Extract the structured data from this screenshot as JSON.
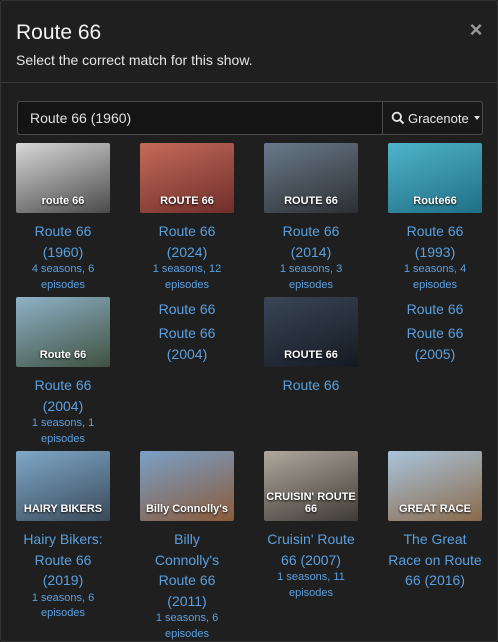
{
  "header": {
    "title": "Route 66",
    "subtitle": "Select the correct match for this show.",
    "close_glyph": "×"
  },
  "search": {
    "value": "Route 66 (1960)",
    "provider_label": "Gracenote"
  },
  "results": [
    {
      "name_lines": [
        "Route 66",
        "(1960)"
      ],
      "meta_lines": [
        "4 seasons, 6",
        "episodes"
      ],
      "thumb_text": "route 66",
      "thumb_colors": [
        "#d8d8d8",
        "#4a4a4a"
      ]
    },
    {
      "name_lines": [
        "Route 66",
        "(2024)"
      ],
      "meta_lines": [
        "1 seasons, 12",
        "episodes"
      ],
      "thumb_text": "ROUTE 66",
      "thumb_colors": [
        "#c56a5a",
        "#6e2e2a"
      ]
    },
    {
      "name_lines": [
        "Route 66",
        "(2014)"
      ],
      "meta_lines": [
        "1 seasons, 3",
        "episodes"
      ],
      "thumb_text": "ROUTE 66",
      "thumb_colors": [
        "#6a7a8a",
        "#2c2f33"
      ]
    },
    {
      "name_lines": [
        "Route 66",
        "(1993)"
      ],
      "meta_lines": [
        "1 seasons, 4",
        "episodes"
      ],
      "thumb_text": "Route66",
      "thumb_colors": [
        "#4fb3c9",
        "#1f6f86"
      ]
    },
    {
      "name_lines": [
        "Route 66",
        "(2004)"
      ],
      "meta_lines": [
        "1 seasons, 1",
        "episodes"
      ],
      "thumb_text": "Route 66",
      "thumb_colors": [
        "#8fb2c8",
        "#3f5140"
      ]
    },
    {
      "title_line": "Route 66",
      "name_lines": [
        "Route 66",
        "(2004)"
      ],
      "meta_lines": []
    },
    {
      "name_lines": [
        "Route 66"
      ],
      "meta_lines": [],
      "thumb_text": "ROUTE 66",
      "thumb_colors": [
        "#3a4656",
        "#141a22"
      ]
    },
    {
      "title_line": "Route 66",
      "name_lines": [
        "Route 66",
        "(2005)"
      ],
      "meta_lines": []
    },
    {
      "name_lines": [
        "Hairy Bikers:",
        "Route 66",
        "(2019)"
      ],
      "meta_lines": [
        "1 seasons, 6",
        "episodes"
      ],
      "thumb_text": "HAIRY BIKERS",
      "thumb_colors": [
        "#7fa8c8",
        "#3a4a5a"
      ]
    },
    {
      "name_lines": [
        "Billy",
        "Connolly's",
        "Route 66",
        "(2011)"
      ],
      "meta_lines": [
        "1 seasons, 6",
        "episodes"
      ],
      "thumb_text": "Billy Connolly's",
      "thumb_colors": [
        "#7aa0c8",
        "#8a5a3a"
      ]
    },
    {
      "name_lines": [
        "Cruisin' Route",
        "66 (2007)"
      ],
      "meta_lines": [
        "1 seasons, 11",
        "episodes"
      ],
      "thumb_text": "CRUISIN' ROUTE 66",
      "thumb_colors": [
        "#b0a89c",
        "#3e3a36"
      ]
    },
    {
      "name_lines": [
        "The Great",
        "Race on Route",
        "66 (2016)"
      ],
      "meta_lines": [],
      "thumb_text": "GREAT RACE",
      "thumb_colors": [
        "#a9c4dc",
        "#8a6a4a"
      ]
    }
  ]
}
